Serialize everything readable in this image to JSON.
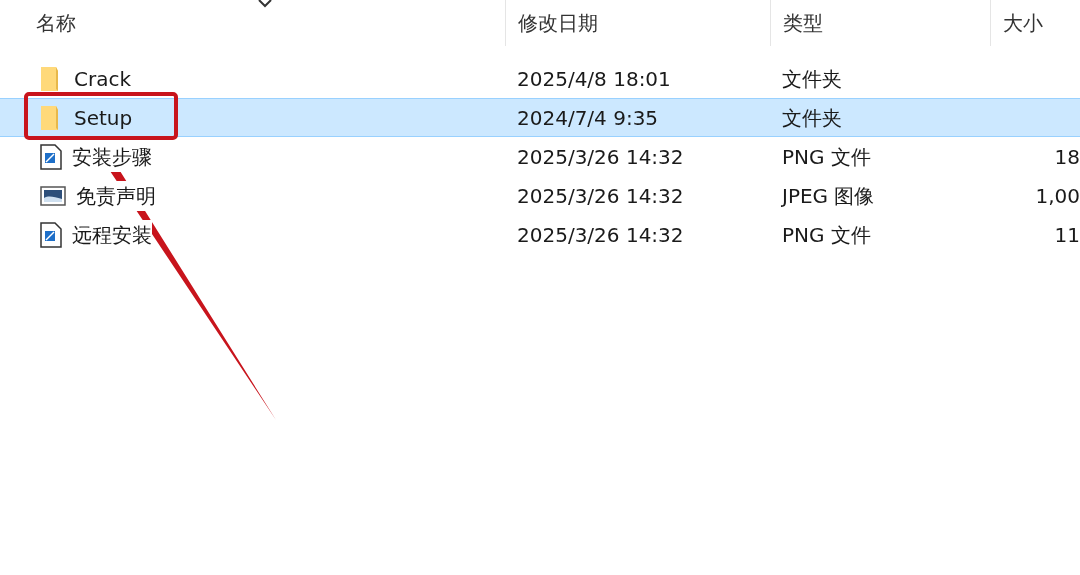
{
  "columns": [
    "名称",
    "修改日期",
    "类型",
    "大小"
  ],
  "rows": [
    {
      "kind": "folder",
      "name": "Crack",
      "modified": "2025/4/8 18:01",
      "type": "文件夹",
      "selected": false
    },
    {
      "kind": "folder",
      "name": "Setup",
      "modified": "2024/7/4 9:35",
      "type": "文件夹",
      "selected": true
    },
    {
      "kind": "png",
      "name": "安装步骤",
      "modified": "2025/3/26 14:32",
      "type": "PNG 文件",
      "size": "18",
      "selected": false
    },
    {
      "kind": "jpeg",
      "name": "免责声明",
      "modified": "2025/3/26 14:32",
      "type": "JPEG 图像",
      "size": "1,00",
      "selected": false
    },
    {
      "kind": "png",
      "name": "远程安装",
      "modified": "2025/3/26 14:32",
      "type": "PNG 文件",
      "size": "11",
      "selected": false
    }
  ]
}
